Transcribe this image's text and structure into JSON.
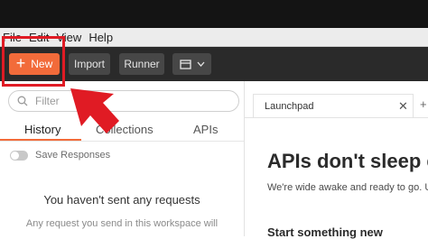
{
  "menu": [
    "File",
    "Edit",
    "View",
    "Help"
  ],
  "toolbar": {
    "new_label": "New",
    "import_label": "Import",
    "runner_label": "Runner"
  },
  "sidebar": {
    "search_placeholder": "Filter",
    "tabs": [
      "History",
      "Collections",
      "APIs"
    ],
    "save_responses_label": "Save Responses",
    "empty_title": "You haven't sent any requests",
    "empty_desc": "Any request you send in this workspace will"
  },
  "main": {
    "tab_label": "Launchpad",
    "heading": "APIs don't sleep ei",
    "subtext": "We're wide awake and ready to go. Use",
    "section_title": "Start something new"
  },
  "colors": {
    "accent": "#f26b3a",
    "highlight": "#e01b24"
  },
  "icons": [
    "plus-icon",
    "workspace-icon",
    "chevron-down-icon",
    "search-icon",
    "close-icon",
    "red-arrow"
  ]
}
